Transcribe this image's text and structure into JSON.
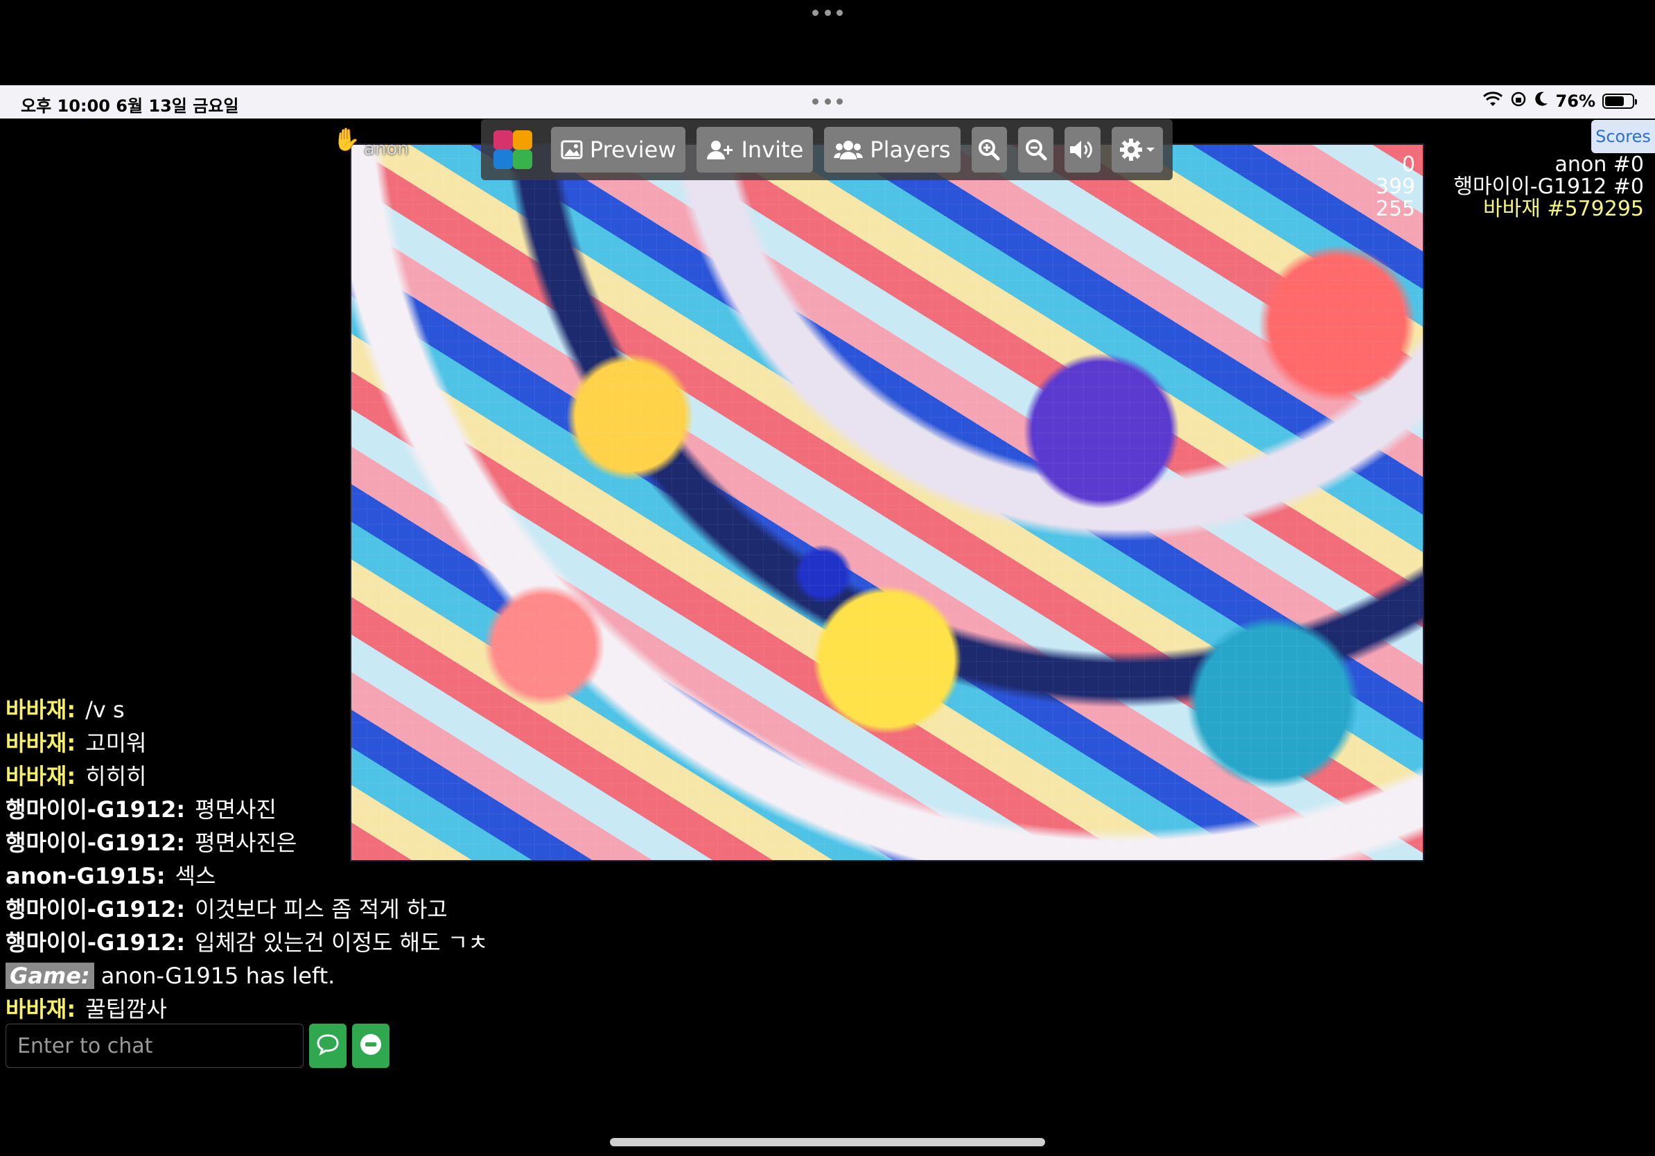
{
  "status_bar": {
    "time_date": "오후 10:00   6월 13일 금요일",
    "battery": "76%",
    "battery_fraction": 0.76
  },
  "toolbar": {
    "preview_label": "Preview",
    "invite_label": "Invite",
    "players_label": "Players"
  },
  "puzzle": {
    "owner_label": "anon"
  },
  "scores": {
    "tab_label": "Scores",
    "rows": [
      {
        "points": "0",
        "name": "anon #0"
      },
      {
        "points": "399",
        "name": "행마이이-G1912 #0"
      },
      {
        "points": "255",
        "name": "바바재 #579295"
      }
    ]
  },
  "chat": {
    "messages": [
      {
        "user": "바바재:",
        "text": "/v s"
      },
      {
        "user": "바바재:",
        "text": "고미워"
      },
      {
        "user": "바바재:",
        "text": "히히히"
      },
      {
        "user": "행마이이-G1912:",
        "text": "평면사진"
      },
      {
        "user": "행마이이-G1912:",
        "text": "평면사진은"
      },
      {
        "user": "anon-G1915:",
        "text": "섹스"
      },
      {
        "user": "행마이이-G1912:",
        "text": "이것보다 피스 좀 적게 하고"
      },
      {
        "user": "행마이이-G1912:",
        "text": "입체감 있는건 이정도 해도 ㄱㅊ"
      },
      {
        "user": "Game:",
        "text": "anon-G1915 has left."
      },
      {
        "user": "바바재:",
        "text": "꿀팁깜사"
      }
    ],
    "input_placeholder": "Enter to chat"
  },
  "colors": {
    "highlight_user": "#f7f06a",
    "toolbar_button": "#7d7d7d",
    "green_button": "#2fa84f",
    "scores_tab_text": "#2d6fd3"
  }
}
